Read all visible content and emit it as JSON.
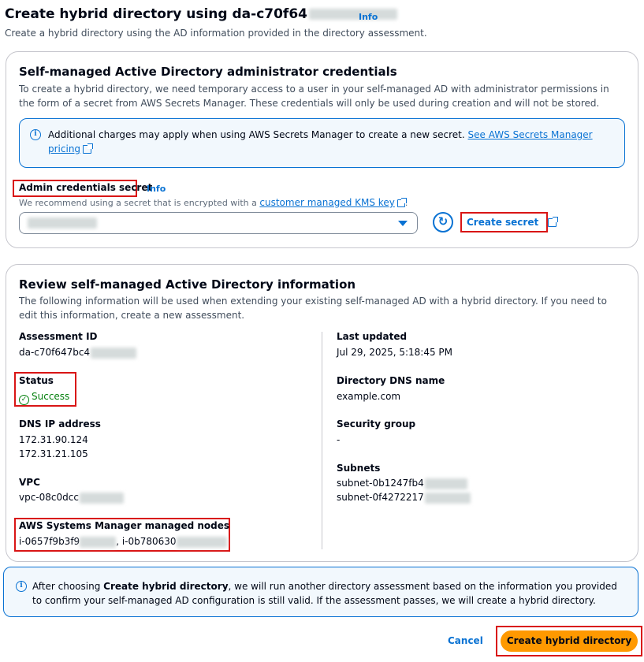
{
  "page": {
    "title": "Create hybrid directory using da-c70f64",
    "info": "Info",
    "description": "Create a hybrid directory using the AD information provided in the directory assessment."
  },
  "credentials": {
    "title": "Self-managed Active Directory administrator credentials",
    "description": "To create a hybrid directory, we need temporary access to a user in your self-managed AD with administrator permissions in the form of a secret from AWS Secrets Manager. These credentials will only be used during creation and will not be stored.",
    "alert_text": "Additional charges may apply when using AWS Secrets Manager to create a new secret.",
    "alert_link": "See AWS Secrets Manager pricing",
    "field_label": "Admin credentials secret",
    "field_info": "Info",
    "hint_text": "We recommend using a secret that is encrypted with a",
    "hint_link": "customer managed KMS key",
    "hint_end": ".",
    "create_secret": "Create secret"
  },
  "review": {
    "title": "Review self-managed Active Directory information",
    "description": "The following information will be used when extending your existing self-managed AD with a hybrid directory. If you need to edit this information, create a new assessment.",
    "assessment_id_label": "Assessment ID",
    "assessment_id_value": "da-c70f647bc4",
    "status_label": "Status",
    "status_value": "Success",
    "dns_ip_label": "DNS IP address",
    "dns_ip_1": "172.31.90.124",
    "dns_ip_2": "172.31.21.105",
    "vpc_label": "VPC",
    "vpc_value": "vpc-08c0dcc",
    "nodes_label": "AWS Systems Manager managed nodes",
    "node_1": "i-0657f9b3f9",
    "node_sep": ",",
    "node_2": "i-0b780630",
    "last_updated_label": "Last updated",
    "last_updated_value": "Jul 29, 2025, 5:18:45 PM",
    "dns_name_label": "Directory DNS name",
    "dns_name_value": "example.com",
    "sg_label": "Security group",
    "sg_value": "-",
    "subnets_label": "Subnets",
    "subnet_1": "subnet-0b1247fb4",
    "subnet_2": "subnet-0f4272217"
  },
  "bottom_alert": {
    "prefix": "After choosing",
    "bold": "Create hybrid directory",
    "suffix": ", we will run another directory assessment based on the information you provided to confirm your self-managed AD configuration is still valid. If the assessment passes, we will create a hybrid directory."
  },
  "actions": {
    "cancel": "Cancel",
    "primary": "Create hybrid directory"
  },
  "icons": [
    "info-circle-icon",
    "external-link-icon",
    "refresh-icon",
    "caret-down-icon",
    "success-check-icon"
  ],
  "colors": {
    "link": "#0972d3",
    "primary": "#ff9900",
    "success": "#037f0c",
    "highlight": "#d91515"
  }
}
